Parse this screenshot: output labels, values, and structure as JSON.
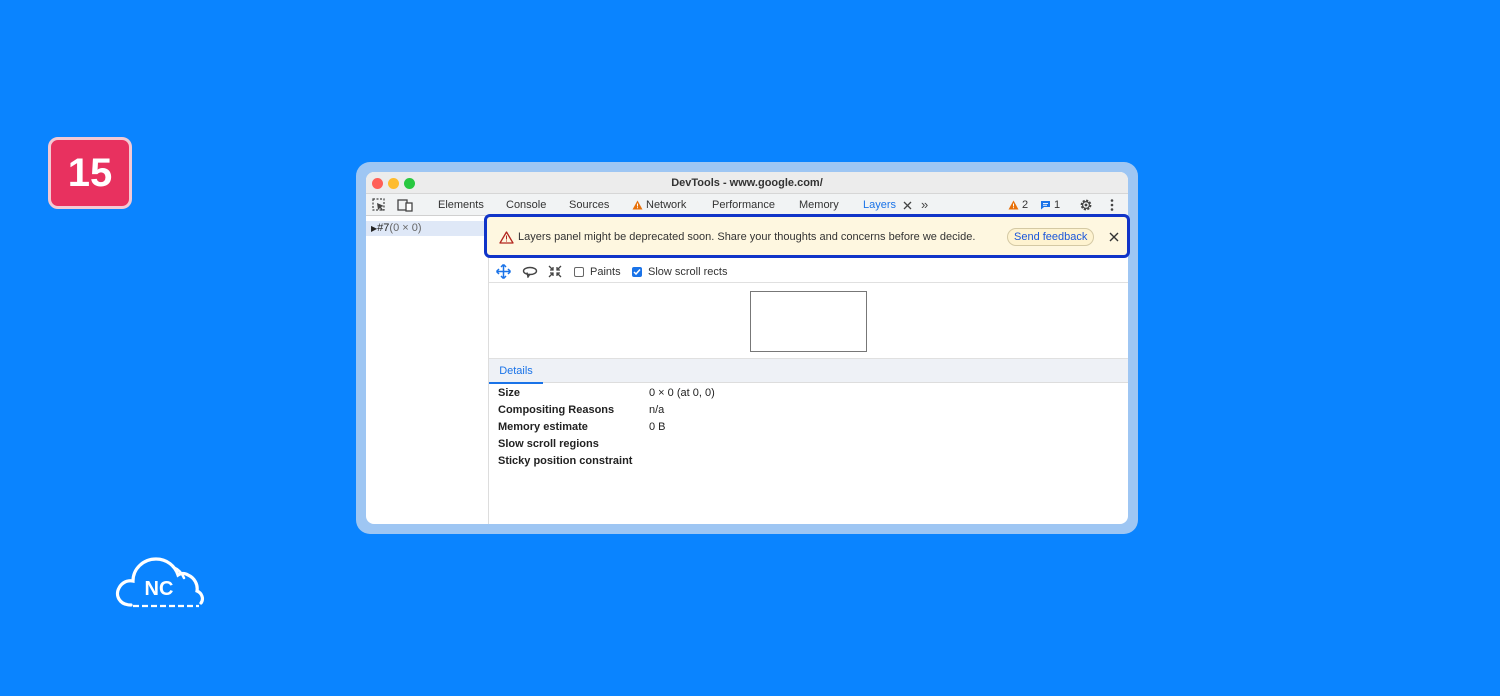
{
  "badge": {
    "number": "15"
  },
  "logo": {
    "text": "NC"
  },
  "window": {
    "title": "DevTools - www.google.com/",
    "traffic_colors": [
      "#ff5f57",
      "#febc2e",
      "#28c840"
    ]
  },
  "tabs": {
    "elements": "Elements",
    "console": "Console",
    "sources": "Sources",
    "network": "Network",
    "performance": "Performance",
    "memory": "Memory",
    "layers": "Layers",
    "more": "»",
    "warnings_count": "2",
    "messages_count": "1"
  },
  "tree": {
    "node_label": "#7",
    "node_size": "(0 × 0)"
  },
  "banner": {
    "message": "Layers panel might be deprecated soon. Share your thoughts and concerns before we decide.",
    "feedback_button": "Send feedback",
    "border_color": "#1034c8"
  },
  "layers_toolbar": {
    "paints_label": "Paints",
    "paints_checked": false,
    "slow_scroll_label": "Slow scroll rects",
    "slow_scroll_checked": true
  },
  "details": {
    "tab_label": "Details",
    "rows": [
      {
        "key": "Size",
        "value": "0 × 0 (at 0, 0)"
      },
      {
        "key": "Compositing Reasons",
        "value": "n/a"
      },
      {
        "key": "Memory estimate",
        "value": "0 B"
      },
      {
        "key": "Slow scroll regions",
        "value": ""
      },
      {
        "key": "Sticky position constraint",
        "value": ""
      }
    ]
  }
}
